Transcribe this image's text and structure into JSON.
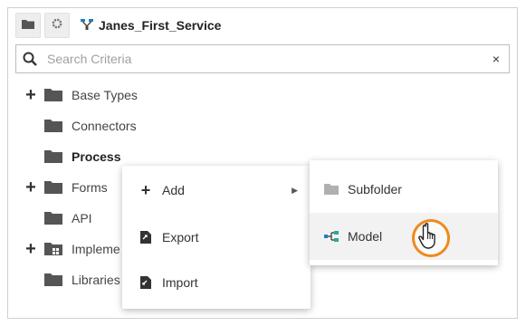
{
  "toolbar": {
    "folder_icon": "folder-icon",
    "settings_icon": "gear-icon",
    "service_icon": "service-icon",
    "service_name": "Janes_First_Service"
  },
  "search": {
    "placeholder": "Search Criteria",
    "value": "",
    "clear_glyph": "×"
  },
  "tree": {
    "items": [
      {
        "label": "Base Types",
        "expander": "+"
      },
      {
        "label": "Connectors",
        "expander": ""
      },
      {
        "label": "Process",
        "expander": ""
      },
      {
        "label": "Forms",
        "expander": "+"
      },
      {
        "label": "API",
        "expander": ""
      },
      {
        "label": "Impleme",
        "expander": "+"
      },
      {
        "label": "Libraries",
        "expander": ""
      }
    ]
  },
  "context_menu": {
    "items": [
      {
        "label": "Add",
        "icon": "plus-icon",
        "glyph": "+"
      },
      {
        "label": "Export",
        "icon": "export-file-icon"
      },
      {
        "label": "Import",
        "icon": "import-file-icon"
      }
    ]
  },
  "sub_menu": {
    "items": [
      {
        "label": "Subfolder",
        "icon": "folder-icon"
      },
      {
        "label": "Model",
        "icon": "model-icon"
      }
    ]
  },
  "colors": {
    "folder": "#555555",
    "accent_ring": "#f08a1c",
    "hover": "#f2f2f2"
  }
}
